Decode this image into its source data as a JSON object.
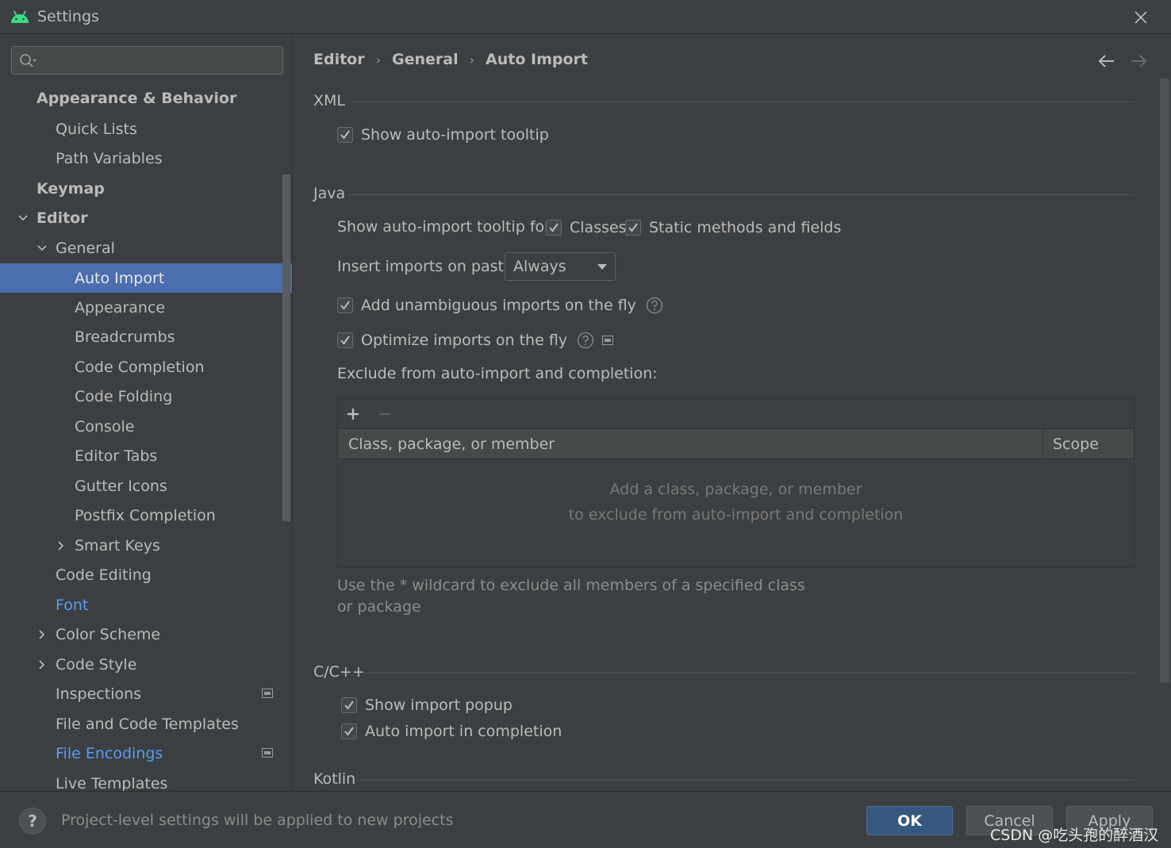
{
  "window": {
    "title": "Settings"
  },
  "search": {
    "placeholder": "",
    "value": ""
  },
  "sidebar": {
    "items": [
      {
        "label": "Appearance & Behavior"
      },
      {
        "label": "Quick Lists"
      },
      {
        "label": "Path Variables"
      },
      {
        "label": "Keymap"
      },
      {
        "label": "Editor"
      },
      {
        "label": "General"
      },
      {
        "label": "Auto Import"
      },
      {
        "label": "Appearance"
      },
      {
        "label": "Breadcrumbs"
      },
      {
        "label": "Code Completion"
      },
      {
        "label": "Code Folding"
      },
      {
        "label": "Console"
      },
      {
        "label": "Editor Tabs"
      },
      {
        "label": "Gutter Icons"
      },
      {
        "label": "Postfix Completion"
      },
      {
        "label": "Smart Keys"
      },
      {
        "label": "Code Editing"
      },
      {
        "label": "Font"
      },
      {
        "label": "Color Scheme"
      },
      {
        "label": "Code Style"
      },
      {
        "label": "Inspections"
      },
      {
        "label": "File and Code Templates"
      },
      {
        "label": "File Encodings"
      },
      {
        "label": "Live Templates"
      }
    ]
  },
  "breadcrumb": {
    "level1": "Editor",
    "level2": "General",
    "level3": "Auto Import",
    "separator": "›"
  },
  "xml": {
    "title": "XML",
    "show_tooltip": {
      "label": "Show auto-import tooltip",
      "checked": true
    }
  },
  "java": {
    "title": "Java",
    "tooltip_for_label": "Show auto-import tooltip for:",
    "classes": {
      "label": "Classes",
      "checked": true
    },
    "static_methods": {
      "label": "Static methods and fields",
      "checked": true
    },
    "insert_on_paste_label": "Insert imports on paste:",
    "insert_on_paste_value": "Always",
    "add_unambiguous": {
      "label": "Add unambiguous imports on the fly",
      "checked": true
    },
    "optimize_imports": {
      "label": "Optimize imports on the fly",
      "checked": true
    },
    "exclude_label": "Exclude from auto-import and completion:",
    "table": {
      "columns": [
        "Class, package, or member",
        "Scope"
      ],
      "empty_line1": "Add a class, package, or member",
      "empty_line2": "to exclude from auto-import and completion"
    },
    "wildcard_hint": "Use the * wildcard to exclude all members of a specified class or package"
  },
  "cpp": {
    "title": "C/C++",
    "show_import_popup": {
      "label": "Show import popup",
      "checked": true
    },
    "auto_import_completion": {
      "label": "Auto import in completion",
      "checked": true
    }
  },
  "kotlin": {
    "title": "Kotlin"
  },
  "footer": {
    "note": "Project-level settings will be applied to new projects",
    "help": "?",
    "ok": "OK",
    "cancel": "Cancel",
    "apply": "Apply",
    "watermark": "CSDN @吃头孢的醉酒汉"
  },
  "colors": {
    "background": "#3c3f41",
    "selection": "#4b6eaf",
    "link": "#589df6",
    "primary_button": "#365880"
  }
}
